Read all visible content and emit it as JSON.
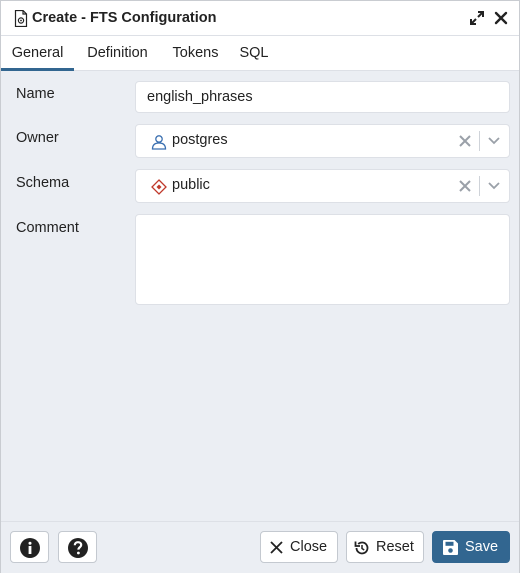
{
  "dialog": {
    "title": "Create - FTS Configuration",
    "title_icon": "document-gear-icon",
    "maximize_icon": "expand-icon",
    "close_icon": "close-icon"
  },
  "tabs": [
    {
      "label": "General",
      "active": true
    },
    {
      "label": "Definition",
      "active": false
    },
    {
      "label": "Tokens",
      "active": false
    },
    {
      "label": "SQL",
      "active": false
    }
  ],
  "form": {
    "name": {
      "label": "Name",
      "value": "english_phrases"
    },
    "owner": {
      "label": "Owner",
      "value": "postgres",
      "icon": "user-icon"
    },
    "schema": {
      "label": "Schema",
      "value": "public",
      "icon": "schema-diamond-icon"
    },
    "comment": {
      "label": "Comment",
      "value": ""
    }
  },
  "footer": {
    "info_icon": "info-icon",
    "help_icon": "help-icon",
    "close_label": "Close",
    "reset_label": "Reset",
    "save_label": "Save"
  },
  "colors": {
    "accent": "#326690",
    "background": "#ebeef3",
    "schema_icon": "#c0392b",
    "user_icon": "#3a6fb0"
  }
}
